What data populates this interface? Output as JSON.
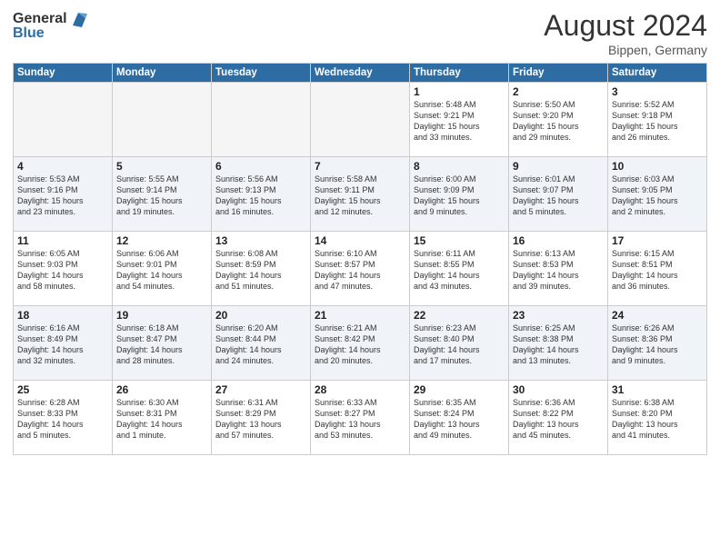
{
  "header": {
    "logo_general": "General",
    "logo_blue": "Blue",
    "month_title": "August 2024",
    "location": "Bippen, Germany"
  },
  "weekdays": [
    "Sunday",
    "Monday",
    "Tuesday",
    "Wednesday",
    "Thursday",
    "Friday",
    "Saturday"
  ],
  "weeks": [
    [
      {
        "day": "",
        "info": ""
      },
      {
        "day": "",
        "info": ""
      },
      {
        "day": "",
        "info": ""
      },
      {
        "day": "",
        "info": ""
      },
      {
        "day": "1",
        "info": "Sunrise: 5:48 AM\nSunset: 9:21 PM\nDaylight: 15 hours\nand 33 minutes."
      },
      {
        "day": "2",
        "info": "Sunrise: 5:50 AM\nSunset: 9:20 PM\nDaylight: 15 hours\nand 29 minutes."
      },
      {
        "day": "3",
        "info": "Sunrise: 5:52 AM\nSunset: 9:18 PM\nDaylight: 15 hours\nand 26 minutes."
      }
    ],
    [
      {
        "day": "4",
        "info": "Sunrise: 5:53 AM\nSunset: 9:16 PM\nDaylight: 15 hours\nand 23 minutes."
      },
      {
        "day": "5",
        "info": "Sunrise: 5:55 AM\nSunset: 9:14 PM\nDaylight: 15 hours\nand 19 minutes."
      },
      {
        "day": "6",
        "info": "Sunrise: 5:56 AM\nSunset: 9:13 PM\nDaylight: 15 hours\nand 16 minutes."
      },
      {
        "day": "7",
        "info": "Sunrise: 5:58 AM\nSunset: 9:11 PM\nDaylight: 15 hours\nand 12 minutes."
      },
      {
        "day": "8",
        "info": "Sunrise: 6:00 AM\nSunset: 9:09 PM\nDaylight: 15 hours\nand 9 minutes."
      },
      {
        "day": "9",
        "info": "Sunrise: 6:01 AM\nSunset: 9:07 PM\nDaylight: 15 hours\nand 5 minutes."
      },
      {
        "day": "10",
        "info": "Sunrise: 6:03 AM\nSunset: 9:05 PM\nDaylight: 15 hours\nand 2 minutes."
      }
    ],
    [
      {
        "day": "11",
        "info": "Sunrise: 6:05 AM\nSunset: 9:03 PM\nDaylight: 14 hours\nand 58 minutes."
      },
      {
        "day": "12",
        "info": "Sunrise: 6:06 AM\nSunset: 9:01 PM\nDaylight: 14 hours\nand 54 minutes."
      },
      {
        "day": "13",
        "info": "Sunrise: 6:08 AM\nSunset: 8:59 PM\nDaylight: 14 hours\nand 51 minutes."
      },
      {
        "day": "14",
        "info": "Sunrise: 6:10 AM\nSunset: 8:57 PM\nDaylight: 14 hours\nand 47 minutes."
      },
      {
        "day": "15",
        "info": "Sunrise: 6:11 AM\nSunset: 8:55 PM\nDaylight: 14 hours\nand 43 minutes."
      },
      {
        "day": "16",
        "info": "Sunrise: 6:13 AM\nSunset: 8:53 PM\nDaylight: 14 hours\nand 39 minutes."
      },
      {
        "day": "17",
        "info": "Sunrise: 6:15 AM\nSunset: 8:51 PM\nDaylight: 14 hours\nand 36 minutes."
      }
    ],
    [
      {
        "day": "18",
        "info": "Sunrise: 6:16 AM\nSunset: 8:49 PM\nDaylight: 14 hours\nand 32 minutes."
      },
      {
        "day": "19",
        "info": "Sunrise: 6:18 AM\nSunset: 8:47 PM\nDaylight: 14 hours\nand 28 minutes."
      },
      {
        "day": "20",
        "info": "Sunrise: 6:20 AM\nSunset: 8:44 PM\nDaylight: 14 hours\nand 24 minutes."
      },
      {
        "day": "21",
        "info": "Sunrise: 6:21 AM\nSunset: 8:42 PM\nDaylight: 14 hours\nand 20 minutes."
      },
      {
        "day": "22",
        "info": "Sunrise: 6:23 AM\nSunset: 8:40 PM\nDaylight: 14 hours\nand 17 minutes."
      },
      {
        "day": "23",
        "info": "Sunrise: 6:25 AM\nSunset: 8:38 PM\nDaylight: 14 hours\nand 13 minutes."
      },
      {
        "day": "24",
        "info": "Sunrise: 6:26 AM\nSunset: 8:36 PM\nDaylight: 14 hours\nand 9 minutes."
      }
    ],
    [
      {
        "day": "25",
        "info": "Sunrise: 6:28 AM\nSunset: 8:33 PM\nDaylight: 14 hours\nand 5 minutes."
      },
      {
        "day": "26",
        "info": "Sunrise: 6:30 AM\nSunset: 8:31 PM\nDaylight: 14 hours\nand 1 minute."
      },
      {
        "day": "27",
        "info": "Sunrise: 6:31 AM\nSunset: 8:29 PM\nDaylight: 13 hours\nand 57 minutes."
      },
      {
        "day": "28",
        "info": "Sunrise: 6:33 AM\nSunset: 8:27 PM\nDaylight: 13 hours\nand 53 minutes."
      },
      {
        "day": "29",
        "info": "Sunrise: 6:35 AM\nSunset: 8:24 PM\nDaylight: 13 hours\nand 49 minutes."
      },
      {
        "day": "30",
        "info": "Sunrise: 6:36 AM\nSunset: 8:22 PM\nDaylight: 13 hours\nand 45 minutes."
      },
      {
        "day": "31",
        "info": "Sunrise: 6:38 AM\nSunset: 8:20 PM\nDaylight: 13 hours\nand 41 minutes."
      }
    ]
  ]
}
